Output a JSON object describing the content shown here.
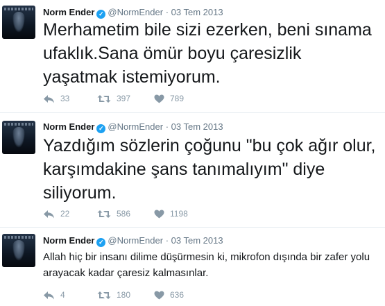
{
  "tweets": [
    {
      "name": "Norm Ender",
      "handle": "@NormEnder",
      "separator": "·",
      "date": "03 Tem 2013",
      "text": "Merhametim bile sizi ezerken, beni sınama ufaklık.Sana ömür boyu çaresizlik yaşatmak istemiyorum.",
      "replies": "33",
      "retweets": "397",
      "likes": "789"
    },
    {
      "name": "Norm Ender",
      "handle": "@NormEnder",
      "separator": "·",
      "date": "03 Tem 2013",
      "text": "Yazdığım sözlerin çoğunu \"bu çok ağır olur, karşımdakine şans tanımalıyım\" diye siliyorum.",
      "replies": "22",
      "retweets": "586",
      "likes": "1198"
    },
    {
      "name": "Norm Ender",
      "handle": "@NormEnder",
      "separator": "·",
      "date": "03 Tem 2013",
      "text": "Allah hiç bir insanı dilime düşürmesin ki, mikrofon dışında bir zafer yolu arayacak kadar çaresiz kalmasınlar.",
      "replies": "4",
      "retweets": "180",
      "likes": "636"
    }
  ],
  "icons": {
    "reply": "reply-icon",
    "retweet": "retweet-icon",
    "like": "heart-icon",
    "verified": "verified-badge-icon"
  },
  "colors": {
    "verified": "#1da1f2",
    "action": "#8899a6",
    "meta": "#657786",
    "text": "#14171a"
  }
}
